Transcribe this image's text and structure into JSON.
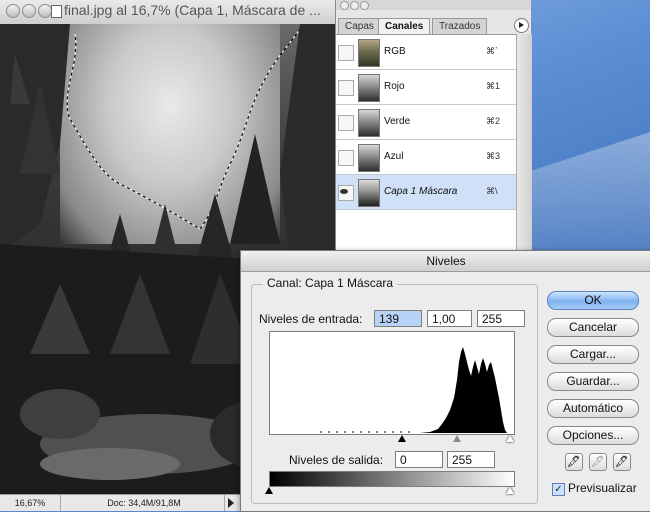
{
  "document": {
    "title": "final.jpg al 16,7% (Capa 1, Máscara de ...",
    "status": {
      "zoom": "16,67%",
      "doc_info": "Doc: 34,4M/91,8M"
    }
  },
  "channels_panel": {
    "tabs": [
      {
        "label": "Capas",
        "active": false
      },
      {
        "label": "Canales",
        "active": true
      },
      {
        "label": "Trazados",
        "active": false
      }
    ],
    "channels": [
      {
        "name": "RGB",
        "shortcut": "⌘`",
        "selected": false,
        "visible": false
      },
      {
        "name": "Rojo",
        "shortcut": "⌘1",
        "selected": false,
        "visible": false
      },
      {
        "name": "Verde",
        "shortcut": "⌘2",
        "selected": false,
        "visible": false
      },
      {
        "name": "Azul",
        "shortcut": "⌘3",
        "selected": false,
        "visible": false
      },
      {
        "name": "Capa 1 Máscara",
        "shortcut": "⌘\\",
        "selected": true,
        "visible": true
      }
    ]
  },
  "levels_dialog": {
    "title": "Niveles",
    "channel_label": "Canal:",
    "channel_value": "Capa 1 Máscara",
    "input_label": "Niveles de entrada:",
    "input_black": "139",
    "input_gamma": "1,00",
    "input_white": "255",
    "output_label": "Niveles de salida:",
    "output_black": "0",
    "output_white": "255",
    "buttons": {
      "ok": "OK",
      "cancel": "Cancelar",
      "load": "Cargar...",
      "save": "Guardar...",
      "auto": "Automático",
      "options": "Opciones..."
    },
    "preview_label": "Previsualizar",
    "preview_checked": true
  }
}
